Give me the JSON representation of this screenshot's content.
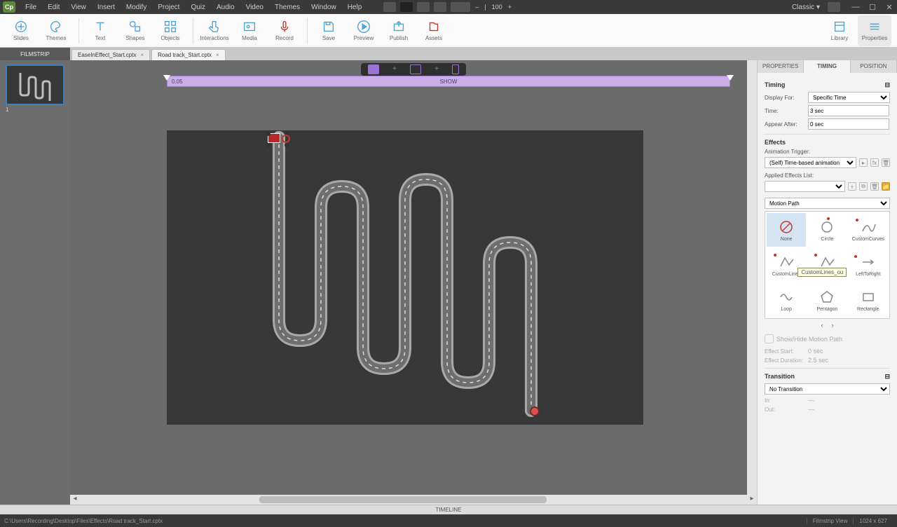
{
  "menubar": {
    "logo": "Cp",
    "items": [
      "File",
      "Edit",
      "View",
      "Insert",
      "Modify",
      "Project",
      "Quiz",
      "Audio",
      "Video",
      "Themes",
      "Window",
      "Help"
    ],
    "workspace": "Classic"
  },
  "toolbar": {
    "items": [
      {
        "label": "Slides",
        "icon": "plus-page"
      },
      {
        "label": "Themes",
        "icon": "palette"
      },
      {
        "sep": true
      },
      {
        "label": "Text",
        "icon": "text"
      },
      {
        "label": "Shapes",
        "icon": "shapes"
      },
      {
        "label": "Objects",
        "icon": "objects"
      },
      {
        "sep": true
      },
      {
        "label": "Interactions",
        "icon": "hand"
      },
      {
        "label": "Media",
        "icon": "media"
      },
      {
        "label": "Record",
        "icon": "mic"
      },
      {
        "sep": true
      },
      {
        "label": "Save",
        "icon": "save"
      },
      {
        "label": "Preview",
        "icon": "play"
      },
      {
        "label": "Publish",
        "icon": "publish"
      },
      {
        "label": "Assets",
        "icon": "assets"
      }
    ],
    "right": [
      {
        "label": "Library",
        "icon": "library"
      },
      {
        "label": "Properties",
        "icon": "properties"
      }
    ]
  },
  "tabs": {
    "filmstrip": "FILMSTRIP",
    "docs": [
      "EaseInEffect_Start.cptx",
      "Road track_Start.cptx"
    ]
  },
  "thumb_num": "1",
  "ruler": {
    "left": "0.05",
    "center": "SHOW"
  },
  "device_labels": [
    "Desktop",
    "+",
    "Tablet",
    "+",
    "Mobile"
  ],
  "panel": {
    "tabs": [
      "PROPERTIES",
      "TIMING",
      "POSITION"
    ],
    "active_tab": 1,
    "timing": {
      "header": "Timing",
      "display_for_label": "Display For:",
      "display_for_value": "Specific Time",
      "time_label": "Time:",
      "time_value": "3 sec",
      "appear_after_label": "Appear After:",
      "appear_after_value": "0 sec"
    },
    "effects": {
      "header": "Effects",
      "trigger_label": "Animation Trigger:",
      "trigger_value": "(Self) Time-based animation",
      "applied_label": "Applied Effects List:",
      "category": "Motion Path",
      "items": [
        {
          "name": "None",
          "sel": true
        },
        {
          "name": "Circle"
        },
        {
          "name": "CustomCurves"
        },
        {
          "name": "CustomLines"
        },
        {
          "name": "CustomLines"
        },
        {
          "name": "LeftToRight"
        },
        {
          "name": "Loop"
        },
        {
          "name": "Pentagon"
        },
        {
          "name": "Rectangle"
        }
      ],
      "tooltip": "CustomLines_ou",
      "smooth_label": "Show/Hide Motion Path",
      "start_label": "Effect Start:",
      "start_value": "0 sec",
      "duration_label": "Effect Duration:",
      "duration_value": "2.5 sec"
    },
    "transition": {
      "header": "Transition",
      "value": "No Transition",
      "in_label": "In:",
      "out_label": "Out:"
    }
  },
  "timeline_label": "TIMELINE",
  "status": {
    "path": "C:\\Users\\Recording\\Desktop\\Files\\Effects\\Road track_Start.cptx",
    "view": "Filmstrip View",
    "dims": "1024 x 627"
  }
}
